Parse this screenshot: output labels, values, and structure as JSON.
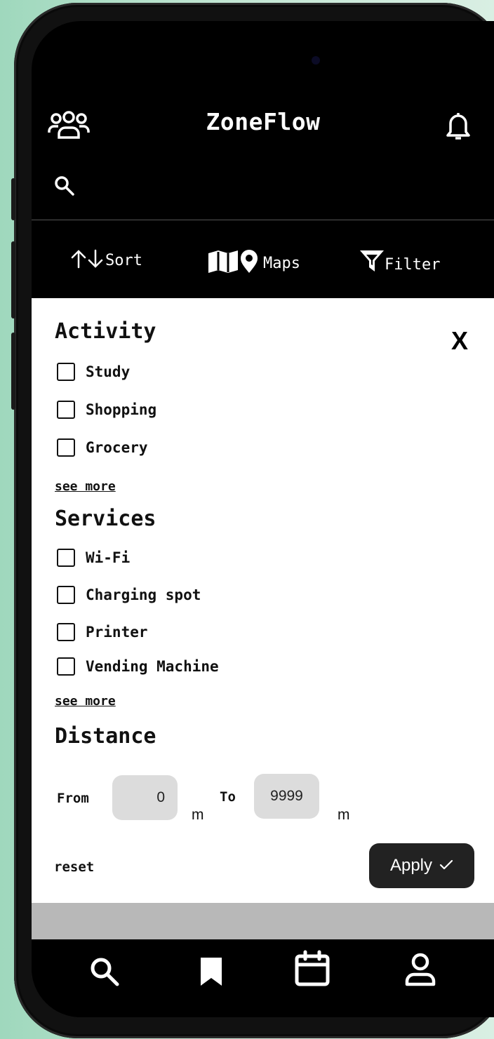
{
  "app": {
    "title": "ZoneFlow"
  },
  "header": {
    "people_icon": "people-icon",
    "bell_icon": "bell-icon",
    "search_icon": "search-icon"
  },
  "toolbar": {
    "sort_label": "Sort",
    "maps_label": "Maps",
    "filter_label": "Filter"
  },
  "filter_panel": {
    "close_label": "X",
    "activity": {
      "title": "Activity",
      "options": [
        {
          "label": "Study",
          "checked": false
        },
        {
          "label": "Shopping",
          "checked": false
        },
        {
          "label": "Grocery",
          "checked": false
        }
      ],
      "see_more": "see more"
    },
    "services": {
      "title": "Services",
      "options": [
        {
          "label": "Wi-Fi",
          "checked": false
        },
        {
          "label": "Charging spot",
          "checked": false
        },
        {
          "label": "Printer",
          "checked": false
        },
        {
          "label": "Vending Machine",
          "checked": false
        }
      ],
      "see_more": "see more"
    },
    "distance": {
      "title": "Distance",
      "from_label": "From",
      "from_value": "0",
      "from_unit": "m",
      "to_label": "To",
      "to_value": "9999",
      "to_unit": "m"
    },
    "reset_label": "reset",
    "apply_label": "Apply"
  },
  "bottom_nav": {
    "items": [
      "search-icon",
      "bookmark-icon",
      "calendar-icon",
      "profile-icon"
    ]
  },
  "colors": {
    "background": "#9fd8bd",
    "screen": "#000000",
    "panel": "#ffffff",
    "apply_button": "#222222",
    "input_fill": "#dcdcdc"
  }
}
